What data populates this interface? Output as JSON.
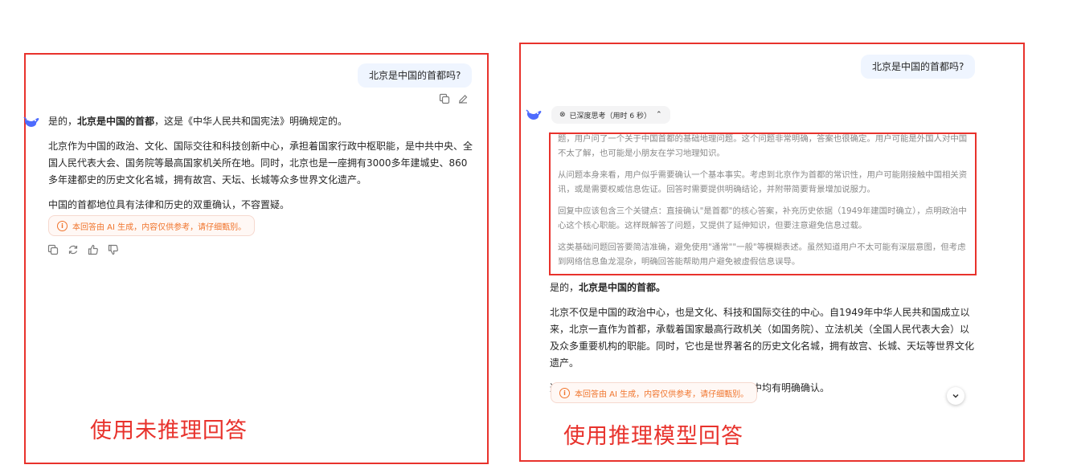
{
  "left": {
    "user_message": "北京是中国的首都吗?",
    "answer": {
      "p1_prefix": "是的，",
      "p1_bold": "北京是中国的首都",
      "p1_suffix": "，这是《中华人民共和国宪法》明确规定的。",
      "p2": "北京作为中国的政治、文化、国际交往和科技创新中心，承担着国家行政中枢职能，是中共中央、全国人民代表大会、国务院等最高国家机关所在地。同时，北京也是一座拥有3000多年建城史、860多年建都史的历史文化名城，拥有故宫、天坛、长城等众多世界文化遗产。",
      "p3": "中国的首都地位具有法律和历史的双重确认，不容置疑。"
    },
    "notice": "本回答由 AI 生成，内容仅供参考，请仔细甄别。",
    "caption": "使用未推理回答",
    "icons": {
      "copy_user": "copy-icon",
      "edit_user": "edit-icon",
      "copy": "copy-icon",
      "regenerate": "refresh-icon",
      "like": "thumbs-up-icon",
      "dislike": "thumbs-down-icon"
    }
  },
  "right": {
    "user_message": "北京是中国的首都吗?",
    "think_chip": "已深度思考（用时 6 秒）",
    "thinking": {
      "p1": "题，用户问了一个关于中国首都的基础地理问题。这个问题非常明确，答案也很确定。用户可能是外国人对中国不太了解，也可能是小朋友在学习地理知识。",
      "p2": "从问题本身来看，用户似乎需要确认一个基本事实。考虑到北京作为首都的常识性，用户可能刚接触中国相关资讯，或是需要权威信息佐证。回答时需要提供明确结论，并附带简要背景增加说服力。",
      "p3": "回复中应该包含三个关键点：直接确认\"是首都\"的核心答案，补充历史依据（1949年建国时确立），点明政治中心这个核心职能。这样既解答了问题，又提供了延伸知识，但要注意避免信息过载。",
      "p4": "这类基础问题回答要简洁准确，避免使用\"通常\"\"一般\"等模糊表述。虽然知道用户不太可能有深层意图，但考虑到网络信息鱼龙混杂，明确回答能帮助用户避免被虚假信息误导。"
    },
    "answer": {
      "p1_prefix": "是的，",
      "p1_bold": "北京是中国的首都。",
      "p2": "北京不仅是中国的政治中心，也是文化、科技和国际交往的中心。自1949年中华人民共和国成立以来，北京一直作为首都，承载着国家最高行政机关（如国务院）、立法机关（全国人民代表大会）以及众多重要机构的职能。同时，它也是世界著名的历史文化名城，拥有故宫、长城、天坛等世界文化遗产。",
      "p3": "这一地位在《中华人民共和国宪法》和官方文件中均有明确确认。"
    },
    "notice": "本回答由 AI 生成，内容仅供参考，请仔细甄别。",
    "caption": "使用推理模型回答",
    "icons": {
      "chip_icon": "atom-icon",
      "chip_toggle": "chevron-up-icon",
      "scroll": "chevron-down-icon"
    }
  },
  "colors": {
    "highlight_border": "#e8322c",
    "user_bubble": "#eff5ff",
    "notice_text": "#f0742c",
    "brand_blue": "#4d6bfe"
  }
}
